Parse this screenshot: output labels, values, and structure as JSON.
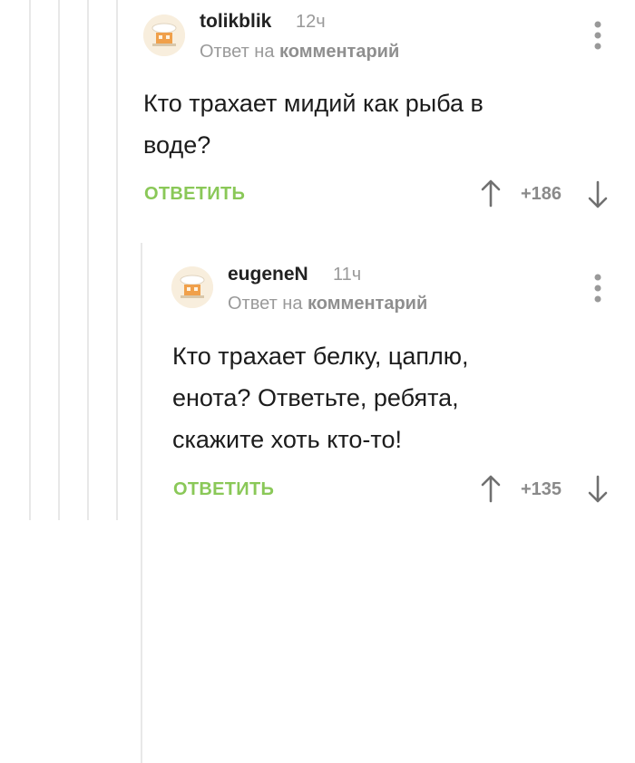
{
  "comments": [
    {
      "username": "tolikblik",
      "time": "12ч",
      "reply_prefix": "Ответ на",
      "reply_link": "комментарий",
      "text_lines": [
        "Кто трахает мидий как рыба в",
        "воде?"
      ],
      "reply_label": "ОТВЕТИТЬ",
      "rating": "+186"
    },
    {
      "username": "eugeneN",
      "time": "11ч",
      "reply_prefix": "Ответ на",
      "reply_link": "комментарий",
      "text_lines": [
        "Кто трахает белку, цаплю,",
        "енота? Ответьте, ребята,",
        "скажите хоть кто-то!"
      ],
      "reply_label": "ОТВЕТИТЬ",
      "rating": "+135"
    }
  ],
  "icons": {
    "avatar": "default-avatar-icon",
    "more": "more-vertical-icon",
    "upvote": "arrow-up-icon",
    "downvote": "arrow-down-icon"
  },
  "colors": {
    "accent_green": "#8ac858",
    "muted_gray": "#9a9a9a",
    "thread_line": "#e8e8e8"
  }
}
